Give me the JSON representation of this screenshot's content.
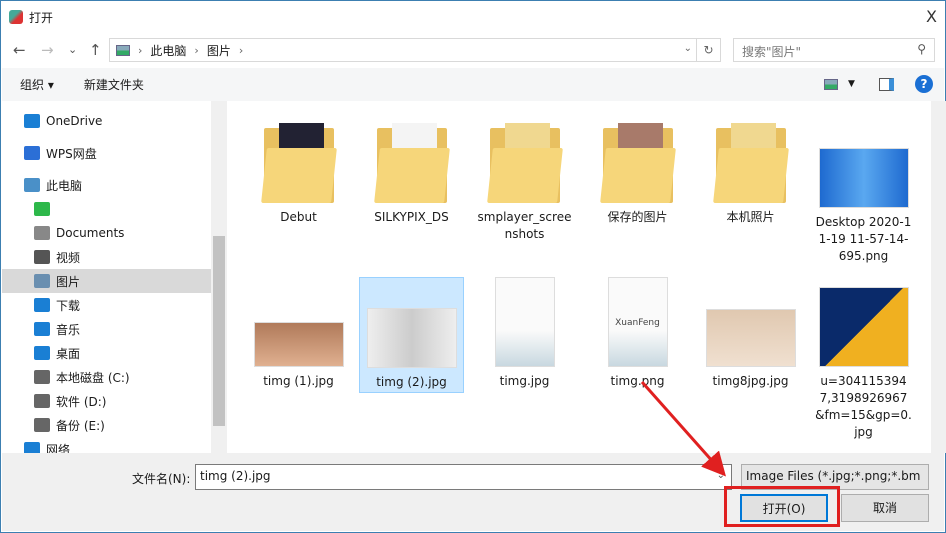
{
  "window": {
    "title": "打开",
    "close": "X"
  },
  "nav": {
    "back": "←",
    "forward": "→",
    "recent": "⌄",
    "up": "↑",
    "breadcrumb": [
      "此电脑",
      "图片"
    ],
    "refresh": "↻",
    "search_placeholder": "搜索\"图片\""
  },
  "toolbar": {
    "organize": "组织 ▾",
    "new_folder": "新建文件夹"
  },
  "sidebar": {
    "items": [
      {
        "label": "OneDrive",
        "color": "#1a7fd4"
      },
      {
        "label": "WPS网盘",
        "color": "#2b6fd6"
      },
      {
        "label": "此电脑",
        "color": "#4a90c8"
      },
      {
        "label": "",
        "color": "#2db84a"
      },
      {
        "label": "Documents",
        "color": "#888"
      },
      {
        "label": "视频",
        "color": "#555"
      },
      {
        "label": "图片",
        "color": "#6a8fb0"
      },
      {
        "label": "下载",
        "color": "#1a7fd4"
      },
      {
        "label": "音乐",
        "color": "#1a7fd4"
      },
      {
        "label": "桌面",
        "color": "#1a7fd4"
      },
      {
        "label": "本地磁盘 (C:)",
        "color": "#666"
      },
      {
        "label": "软件 (D:)",
        "color": "#666"
      },
      {
        "label": "备份 (E:)",
        "color": "#666"
      },
      {
        "label": "网络",
        "color": "#1a7fd4"
      }
    ]
  },
  "files": [
    {
      "name": "Debut",
      "type": "folder"
    },
    {
      "name": "SILKYPIX_DS",
      "type": "folder"
    },
    {
      "name": "smplayer_screenshots",
      "type": "folder"
    },
    {
      "name": "保存的图片",
      "type": "folder"
    },
    {
      "name": "本机照片",
      "type": "folder"
    },
    {
      "name": "Desktop 2020-11-19 11-57-14-695.png",
      "type": "image"
    },
    {
      "name": "timg (1).jpg",
      "type": "image"
    },
    {
      "name": "timg (2).jpg",
      "type": "image",
      "selected": true
    },
    {
      "name": "timg.jpg",
      "type": "image"
    },
    {
      "name": "timg.png",
      "type": "image",
      "caption": "XuanFeng"
    },
    {
      "name": "timg8jpg.jpg",
      "type": "image"
    },
    {
      "name": "u=3041153947,3198926967&fm=15&gp=0.jpg",
      "type": "image"
    }
  ],
  "bottom": {
    "filename_label": "文件名(N):",
    "filename_value": "timg (2).jpg",
    "filetype": "Image Files (*.jpg;*.png;*.bm",
    "open": "打开(O)",
    "cancel": "取消"
  },
  "colors": {
    "accent": "#0078d7",
    "highlight": "#e02020"
  }
}
